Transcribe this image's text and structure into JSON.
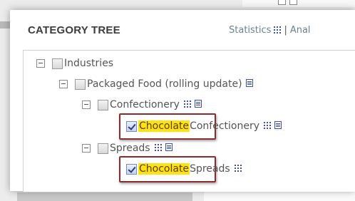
{
  "panel": {
    "title": "CATEGORY TREE",
    "links": {
      "statistics_label": "Statistics",
      "separator": "|",
      "analysis_label": "Anal"
    }
  },
  "tree": {
    "industries": {
      "label": "Industries",
      "checked": false
    },
    "packaged_food": {
      "label": "Packaged Food (rolling update)",
      "checked": false
    },
    "confectionery": {
      "label": "Confectionery",
      "checked": false
    },
    "chocolate_confectionery": {
      "highlight": "Chocolate",
      "rest": "Confectionery",
      "checked": true
    },
    "spreads": {
      "label": "Spreads",
      "checked": false
    },
    "chocolate_spreads": {
      "highlight": "Chocolate",
      "rest": "Spreads",
      "checked": true
    }
  },
  "colors": {
    "highlight": "#ffe20f",
    "callout_border": "#8b2d2d",
    "link_text": "#6a7f8f",
    "icon_blue": "#3d4fb5"
  },
  "icons": [
    "grid-icon",
    "document-icon",
    "checkbox-icon",
    "collapse-icon"
  ]
}
